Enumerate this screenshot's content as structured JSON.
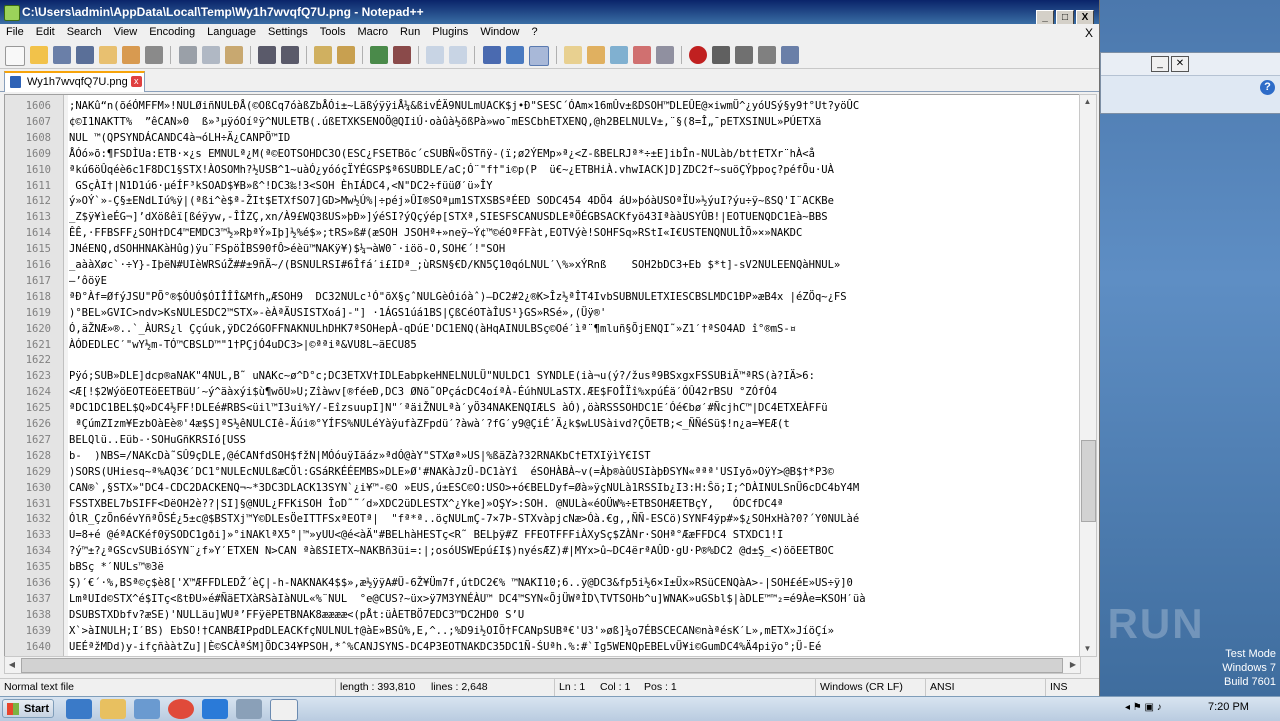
{
  "window": {
    "title": "C:\\Users\\admin\\AppData\\Local\\Temp\\Wy1h7wvqfQ7U.png - Notepad++",
    "min": "_",
    "max": "□",
    "close": "X"
  },
  "menu": [
    "File",
    "Edit",
    "Search",
    "View",
    "Encoding",
    "Language",
    "Settings",
    "Tools",
    "Macro",
    "Run",
    "Plugins",
    "Window",
    "?"
  ],
  "menu_close": "X",
  "tab": {
    "label": "Wy1h7wvqfQ7U.png",
    "close": "x"
  },
  "editor_lines": [
    {
      "n": "1606",
      "t": ";NAKû“n(õéÓMFFM»!NULØiñNULÐÅ(©OßCq7óàßZbÅÓi±~LäßýÿÿiÅ¼&ßivÉÄ9NULmUACK$j•Ð\"SESC´ÓAm×16mÛv±ßDSOH™DLEÛE@×iwmÜ^¿yóUSý§y9†°Ut?yöÛC"
    },
    {
      "n": "1607",
      "t": "¢©I1NAKTT%  ”êCAN»0  ß»³µÿóOíºÿ^NULETB(.úßETXKSENOÖ@QI­iÚ·oàûà½õßPà»wo¯mESCbhETXENQ,@h2BELNULV±,¨§(8=Î„¯pETXSINUL»PÚETXä"
    },
    {
      "n": "1608",
      "t": "NUL ™(QPSYNDÁCANDC4à¬óLH÷Ä¿CANPÖ™ID"
    },
    {
      "n": "1609",
      "t": "ÅÓó»õ:¶FSDÌUa:ETB·×¿s EMNULª¿M(ª©EOTSOHDC3O(ESC¿FSETBõc´cSUBÑ«ÖSTñÿ-(ï;ø2ÝEMp»ª¿<Z-ßBELRJª*÷±E]ibÎn-NULàb/bt†ETXr¨hÀ<å"
    },
    {
      "n": "1610",
      "t": "ªkú6öÛqéè6c1F8DC1§STX!ÀOSOMh?½USB^1~uàÓ¿yóóçÏYÉGSP$ª6SUBDLE/aC;Ó¨\"f†\"i©p(P  ü€~¿ETBHiÀ.vhwIACK]D]ZDC2f~suöÇÝþpoç?péfÕu·UÀ"
    },
    {
      "n": "1611",
      "t": " GSçÀI†|N1D1ú6·µéÍF³kSOAD$¥B»ß^!DC3‰!3<SOH ÈhIÁDC4,<N\"DC2÷füüØ′ü»ÎY"
    },
    {
      "n": "1612",
      "t": "ý»OÝ`»-Ç§±ENdLIú%ÿ|(ªßi^è$ª-ŽIt$ETXfSO7]GD>Mw½Ú%|÷péj»ÛI®SOªµm1STXSBSªÉED SODC454 4DÖ4 áU»þóàUSOªÏU»½ýuI?ýu÷ÿ~ßSQ'I¨ACKBe"
    },
    {
      "n": "1613",
      "t": "_Z$ÿ¥ìeÉG¬]’dXößêï[ßéÿyw,-ÎÎZÇ,xn/À9£WQ3ßUS»þÐ»]ýéSI?ýQçýép[STXª,SIESFSCANUSDLEªÖÉGBSACKfyö43IªààUSYÛB!|EOTUENQDC1Eà~BBS"
    },
    {
      "n": "1614",
      "t": "ÊÊ,·FFBSFF¿SOH†DC4™EMDC3™½»RþªÝ»Iþ]½%é$»;tRS»ß#(æSOH JSOHª+»neÿ~Ý¢™©éOªFFàt,EOTVýè!SOHFSq»RStI«I€USTENQNULÌÕ»×»NAKDC"
    },
    {
      "n": "1615",
      "t": "JNéENQ,dSOHHNAKàHûg)ÿu¨FSpöÌBS90fÔ>éèü™NAKÿ¥)$¼¬àW0¯·iöö-O,SOH€´!\"SOH"
    },
    {
      "n": "1616",
      "t": "_aààXøc`·÷Y}-IþëN#UIèWRSúŽ##±9ñÄ~/(BSNULRSI#6Îfá′i£IDª_;ùRSN§€D/KN5Ç10qóLNUL′\\%»xÝRnß    SOH2bDC3+Eb $*t]-sV2NULEENQàHNUL»"
    },
    {
      "n": "1617",
      "t": "–’ôöÿE"
    },
    {
      "n": "1618",
      "t": "ªÐ°Àf=ØfýJSU\"PÕ°®$ÓUÓ$ÓIÎÎÎ&Mfh„ÆSOH9  DC32NULc¹Ó\"õX§çˆNULGèÓióàˆ)—DC2#2¿®K>Îz½ªÎT4IvbSUBNULETXIESCBSLMDC1ÐP»æB4x |éZÖq~¿FS"
    },
    {
      "n": "1619",
      "t": ")°BEL»GVIC>ndv>KsNULESDC2™STX»-èÀªÄUSISTXoá]-\"] ·1ÁGS1úá1BS|ÇßCéOTàÎUS¹}GS»RSé»­,(Üÿ®'"
    },
    {
      "n": "1620",
      "t": "Ó,äŽNÆ»®..`_ÀURS¿l Ççúuk,ÿDC2óGOFFNAKNULhDHK7ªSOHepÀ-qDúE'DC1ENQ(àHqAINULBSç©Oé′ìª¨¶mluñ§ÕjENQI˜»Z1′†ªSO4AD î°®mS-¤"
    },
    {
      "n": "1621",
      "t": "ÀÓDEDLEC′\"wY½m-TÓ™CBSLD™\"1†PÇjÓ4uDC3>|©ªªiª&VU8L~äECU85"
    },
    {
      "n": "1622",
      "t": ""
    },
    {
      "n": "1623",
      "t": "Pÿó;SUB»DLE]dcp®aNAK\"4NUL,B˜ uNAKc~ø^D°c;DC3ETXV†IDLEabpkeHNELNULÜ\"NULDC1 SYNDLE(ià¬u(ý?/žusª9BSxgxFSSUBiÄ™ªRS(à?IÄ>6:"
    },
    {
      "n": "1624",
      "t": "<Æ[!$2WýöEOTEöEETBüU′~ý^äàxýi$ù¶wõU»U;Zîàwv[®féeÐ,DC3 ØNõ˜OPçácDC4oíªÀ-ÉúhNULaSTX.ÆE$FOÎÏî%xpúÉä′ÓÛ42rBSU °ZÓfÓ4"
    },
    {
      "n": "1625",
      "t": "ªDC1DC1BEL$Q»DC4½FF!DLEé#RBS<üil™I3ui%Y/-EîzsuupI]N\"′ªäiŽNULªà′yÖ34NAKENQIÆLS àÓ),öàRSSSOHDC1E′Óé€bø′#ÑcjhC™|DC4ETXEÀFFü"
    },
    {
      "n": "1626",
      "t": " ªÇúmZIzm¥EzbOàEè®'4æ$S]ªS½êNULCIê-Äúi®°YÍFS%NULéYàÿufàZFpdü′?àwà′?fG′y9@ÇiÉ′Ä¿k$wLUSàivd?ÇÕETB;<_ÑÑéSü$!n¿a=¥EÆ(t"
    },
    {
      "n": "1627",
      "t": "BELQlü..Eüb-·SOHuGñKRSIó[USS"
    },
    {
      "n": "1628",
      "t": "b-  )NBS=/NAKcDà˜SÛ9çDLE,@éCANfdSOH$fžN|MÓóuÿIäáz»ªdÓ@àY\"STXøª»US|%ßäZà?32RNAKbC†ETXIÿìY€IST"
    },
    {
      "n": "1629",
      "t": ")SORS(UHiesq~ª%AQ3€′DC1°NULEcNULßæCÖl:GSáRKÉÉEMBS»DLE»Ø'#NAKàJzÛ-DC1àYî  éSOHÀBÀ~v(=Àþ®àûUSIàþÐSYN«ªªª'USIyõ»OÿY>@B$†*P3©"
    },
    {
      "n": "1630",
      "t": "CAN®`,§STX»\"DC4-CDC2DACKENQ¬~*3DC3DLACK13SYN`¿i¥™-©O »EUS,ú±ESC©O:USO>+ó€BELDyf=Øà»ÿçNULà1RSSIb¿I3:H:Ŝö;I;^DÀINULSnÜ6cDC4bY4M"
    },
    {
      "n": "1631",
      "t": "FSSTXBEL7bSIFF<DëOH2è??|SI]§@NUL¿FFKiSOH ÎoD˜˜´d»XDC2üDLESTX^¿Yke]»OŞY>:SOH. @NULà«éOÜW%÷ETBSOHÆETBçY,   ÓDCfDC4ª"
    },
    {
      "n": "1632",
      "t": "ÓlR_ÇzÕn6évYñªÕSÉ¿5±c@$BSTXj™Y©DLEsÖeITTFSxªEOTª|  \"fª*ª..öçNULmÇ-7×7Þ-STXvàpjcNæ>Óà.€g,,ÑÑ-ESCö)SYNF4ÿp#»$¿SOHxHà?0?´Y0NULàé"
    },
    {
      "n": "1633",
      "t": "U=8+é @éªACKéf0ÿSODC1gði]»°iNAKlªX5°|™»yUU<@é<àÄ\"#BELhàHESTç<R˜ BELþÿ#Z FFEOTFFFiÀXySç$ZÀNr·SOHª°ÆæFFDC4 STXDC1!I"
    },
    {
      "n": "1634",
      "t": "?ý™±?¿ªGScvSUBióSYN¨¿f»Y′ETXEN N>CAN ªàßSIETX~NAKBñ3üi=:|;osóUSWEpú£I$)nyésÆZ)#|MYx>û~DC4ërªAÛD·gU·P®%DC2 @d±Ş_<)öõEETBOC"
    },
    {
      "n": "1635",
      "t": "bBSç *′NULs™®3ë"
    },
    {
      "n": "1636",
      "t": "Ş)′€´·%,BSª©ç$è8['X™ÆFFDLEDŽ´èÇ|-h-NAKNAK4$$»,æ½ÿÿA#Ü-6Ž¥Üm7f,útDC2€% ™NAKI10;6..ÿ@DC3&fp5i½6×I±Üx»RSüCENQàA>-|SOH£éE»US÷ÿ]0"
    },
    {
      "n": "1637",
      "t": "LmªUId©STX^é$ITç<ßtÐU»é#ÑäETXàRSàIàNUL«%¨NUL  °e@CUS?~üx>ÿ7M3YNÉÀU™ DC4™SYN«ÕjÜWªÌD\\TVTSOHb^u]WNAK»uGSbl$|àDLE™™₂=é9Àe=KSOH′üà"
    },
    {
      "n": "1638",
      "t": "DSUBSTXDbfv?æSE)'NULLäu]WUª’FFÿëPETBNAK8ææææ<(pÅt:üÀETBÖ7EDC3™DC2HD0 S’U"
    },
    {
      "n": "1639",
      "t": "X`>àINULH;I′BS) EbSO!†CANBÆIPpdDLEACKfçNULNUL†@àE»BSû%,E,^..;%D9i½OIÕ†FCANpSUBª€'U3'»øß]¼o7ÉBSCECAN©nàªésK′L»,mETX»JíöÇí»"
    },
    {
      "n": "1640",
      "t": "UEÉªžMDd)y-ifçñààtZu]|È©SCÀªŚM]ÕDC34¥PSOH,*ˆ%CANJSYNS-DC4P3EOTNAKDC35DC1Ñ-ŚUªh.%:#`Ig5WENQpEBELvÜ¥i©GumDC4%Ä4piÿo°;Ü-Eé"
    }
  ],
  "status": {
    "type": "Normal text file",
    "length": "length : 393,810",
    "lines": "lines : 2,648",
    "ln": "Ln : 1",
    "col": "Col : 1",
    "pos": "Pos : 1",
    "eol": "Windows (CR LF)",
    "encoding": "ANSI",
    "ins": "INS"
  },
  "taskbar": {
    "start": "Start",
    "time": "7:20 PM"
  },
  "desktop": {
    "testmode_1": "Test Mode",
    "testmode_2": "Windows 7",
    "testmode_3": "Build 7601",
    "watermark": "ANY RUN"
  }
}
